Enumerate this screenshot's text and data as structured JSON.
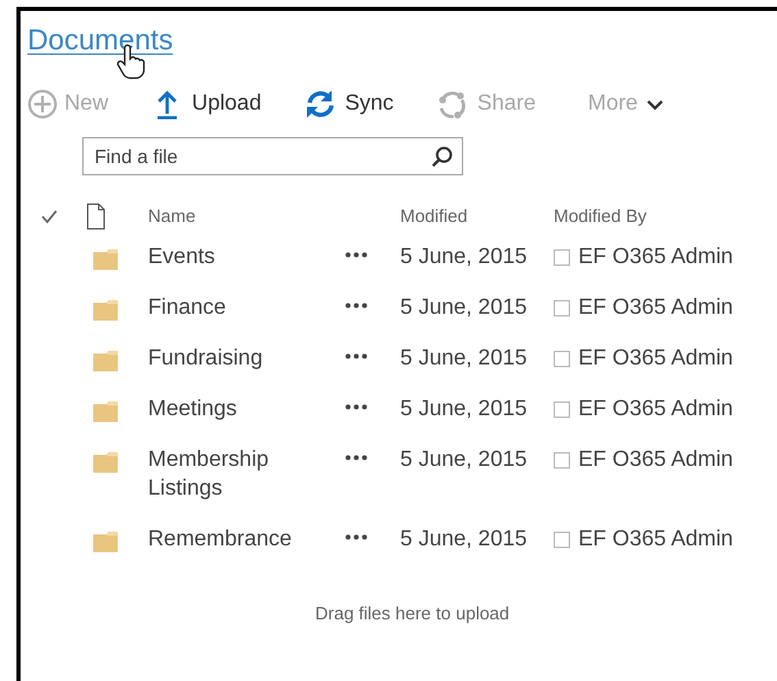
{
  "title": "Documents",
  "commands": [
    {
      "kind": "new",
      "label": "New",
      "disabled": true
    },
    {
      "kind": "upload",
      "label": "Upload",
      "disabled": false
    },
    {
      "kind": "sync",
      "label": "Sync",
      "disabled": false
    },
    {
      "kind": "share",
      "label": "Share",
      "disabled": true
    },
    {
      "kind": "more",
      "label": "More",
      "disabled": true
    }
  ],
  "search": {
    "placeholder": "Find a file"
  },
  "table": {
    "columns": [
      "Name",
      "Modified",
      "Modified By"
    ],
    "rows": [
      {
        "name": "Events",
        "modified": "5 June, 2015",
        "modified_by": "EF O365 Admin"
      },
      {
        "name": "Finance",
        "modified": "5 June, 2015",
        "modified_by": "EF O365 Admin"
      },
      {
        "name": "Fundraising",
        "modified": "5 June, 2015",
        "modified_by": "EF O365 Admin"
      },
      {
        "name": "Meetings",
        "modified": "5 June, 2015",
        "modified_by": "EF O365 Admin"
      },
      {
        "name": "Membership Listings",
        "modified": "5 June, 2015",
        "modified_by": "EF O365 Admin"
      },
      {
        "name": "Remembrance",
        "modified": "5 June, 2015",
        "modified_by": "EF O365 Admin"
      }
    ]
  },
  "drop_hint": "Drag files here to upload"
}
